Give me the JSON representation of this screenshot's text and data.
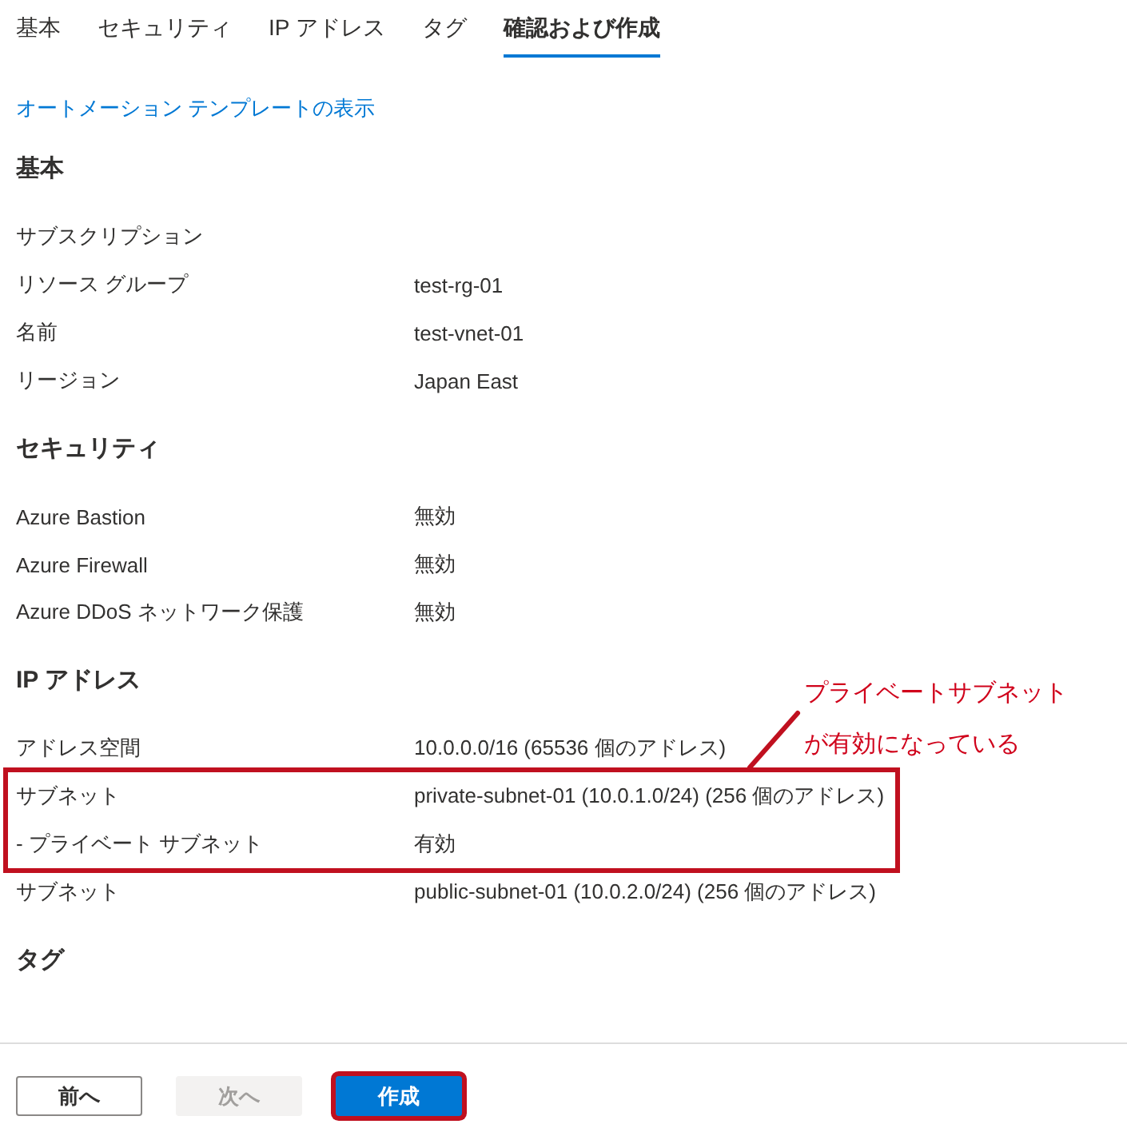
{
  "tabs": [
    {
      "label": "基本",
      "selected": false
    },
    {
      "label": "セキュリティ",
      "selected": false
    },
    {
      "label": "IP アドレス",
      "selected": false
    },
    {
      "label": "タグ",
      "selected": false
    },
    {
      "label": "確認および作成",
      "selected": true
    }
  ],
  "template_link": "オートメーション テンプレートの表示",
  "sections": [
    {
      "title": "基本",
      "rows": [
        {
          "label": "サブスクリプション",
          "highlighted": false
        },
        {
          "label": "リソース グループ",
          "value": "test-rg-01",
          "highlighted": false
        },
        {
          "label": "名前",
          "value": "test-vnet-01",
          "highlighted": false
        },
        {
          "label": "リージョン",
          "value": "Japan East",
          "highlighted": false
        }
      ]
    },
    {
      "title": "セキュリティ",
      "rows": [
        {
          "label": "Azure Bastion",
          "value": "無効",
          "highlighted": false
        },
        {
          "label": "Azure Firewall",
          "value": "無効",
          "highlighted": false
        },
        {
          "label": "Azure DDoS ネットワーク保護",
          "value": "無効",
          "highlighted": false
        }
      ]
    },
    {
      "title": "IP アドレス",
      "rows": [
        {
          "label": "アドレス空間",
          "value": "10.0.0.0/16 (65536 個のアドレス)",
          "highlighted": false
        },
        {
          "label": "サブネット",
          "value": "private-subnet-01 (10.0.1.0/24) (256 個のアドレス)",
          "highlighted": true
        },
        {
          "label": "- プライベート サブネット",
          "value": "有効",
          "highlighted": true
        },
        {
          "label": "サブネット",
          "value": "public-subnet-01 (10.0.2.0/24) (256 個のアドレス)",
          "highlighted": false
        }
      ]
    },
    {
      "title": "タグ"
    }
  ],
  "annotation": {
    "lines": [
      "プライベートサブネット",
      "が有効になっている"
    ]
  },
  "buttons": [
    {
      "label": "前へ",
      "kind": "secondary",
      "disabled": false,
      "highlighted": false
    },
    {
      "label": "次へ",
      "kind": "secondary",
      "disabled": true,
      "highlighted": false
    },
    {
      "label": "作成",
      "kind": "primary",
      "disabled": false,
      "highlighted": true
    }
  ]
}
